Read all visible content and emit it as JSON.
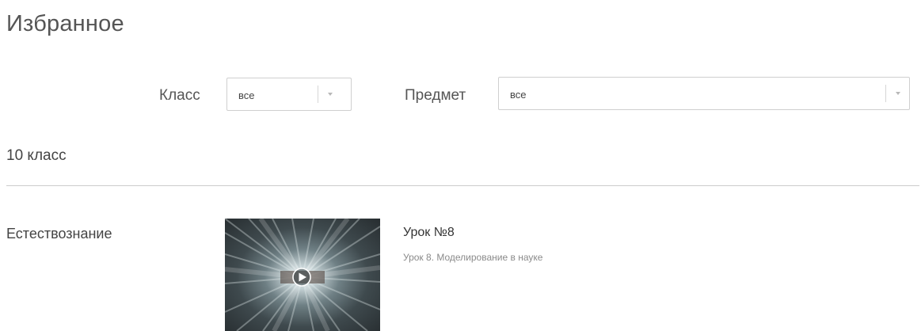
{
  "page": {
    "title": "Избранное"
  },
  "filters": {
    "class_label": "Класс",
    "class_value": "все",
    "subject_label": "Предмет",
    "subject_value": "все"
  },
  "groups": [
    {
      "heading": "10 класс",
      "subjects": [
        {
          "name": "Естествознание",
          "lessons": [
            {
              "title": "Урок №8",
              "description": "Урок 8. Моделирование в науке",
              "thumbnail_icon": "play-icon"
            }
          ]
        }
      ]
    }
  ]
}
